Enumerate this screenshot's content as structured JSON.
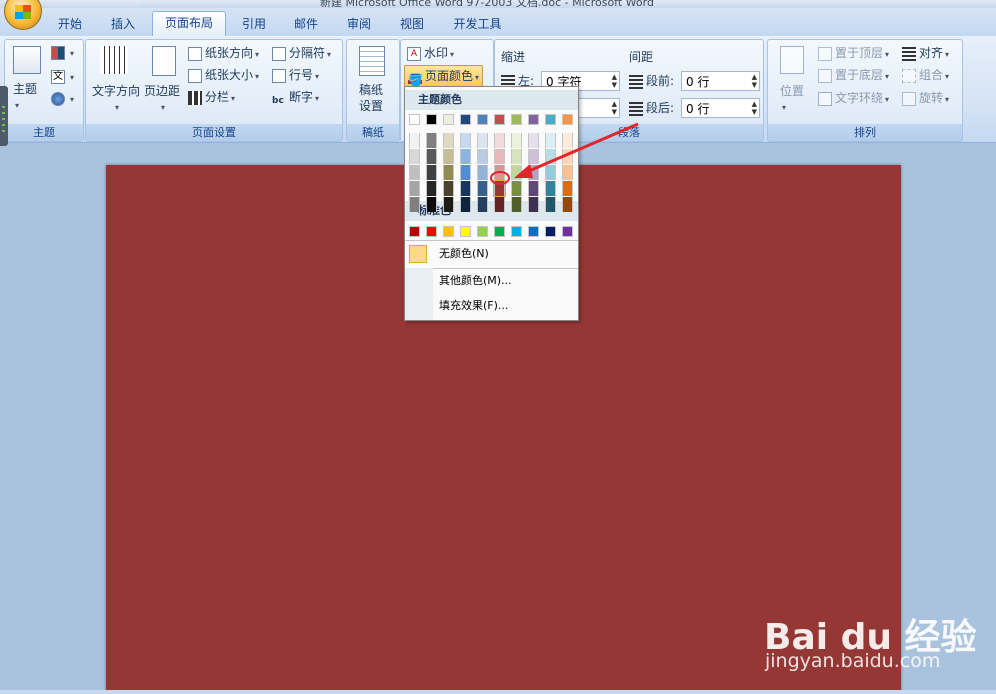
{
  "window": {
    "title": "新建 Microsoft Office Word 97-2003 文档.doc - Microsoft Word"
  },
  "tabs": [
    {
      "label": "开始"
    },
    {
      "label": "插入"
    },
    {
      "label": "页面布局"
    },
    {
      "label": "引用"
    },
    {
      "label": "邮件"
    },
    {
      "label": "审阅"
    },
    {
      "label": "视图"
    },
    {
      "label": "开发工具"
    }
  ],
  "active_tab": "页面布局",
  "ribbon": {
    "theme_group": {
      "label": "主题",
      "theme_button": "主题",
      "colors_button": "",
      "fonts_button": "文",
      "effects_button": ""
    },
    "page_setup_group": {
      "label": "页面设置",
      "text_direction": "文字方向",
      "margins": "页边距",
      "orientation": "纸张方向",
      "size": "纸张大小",
      "columns": "分栏",
      "breaks": "分隔符",
      "line_numbers": "行号",
      "hyphenation": "断字"
    },
    "draft_group": {
      "label": "稿纸",
      "button": "稿纸\n设置",
      "button_line1": "稿纸",
      "button_line2": "设置"
    },
    "background_group": {
      "watermark": "水印",
      "page_color": "页面颜色"
    },
    "paragraph_group": {
      "label": "段落",
      "indent_title": "缩进",
      "spacing_title": "间距",
      "indent_left_label": "左:",
      "indent_left_value": "0 字符",
      "spacing_before_label": "段前:",
      "spacing_before_value": "0 行",
      "spacing_after_label": "段后:",
      "spacing_after_value": "0 行"
    },
    "arrange_group": {
      "label": "排列",
      "position": "位置",
      "bring_to_front": "置于顶层",
      "send_to_back": "置于底层",
      "text_wrapping": "文字环绕",
      "align": "对齐",
      "group": "组合",
      "rotate": "旋转"
    }
  },
  "page_color_menu": {
    "theme_colors_header": "主题颜色",
    "standard_colors_header": "标准色",
    "theme_top_row": [
      "#ffffff",
      "#000000",
      "#eeece1",
      "#1f497d",
      "#4f81bd",
      "#c0504d",
      "#9bbb59",
      "#8064a2",
      "#4bacc6",
      "#f79646"
    ],
    "theme_shades": [
      [
        "#f2f2f2",
        "#7f7f7f",
        "#ddd9c3",
        "#c6d9f0",
        "#dbe5f1",
        "#f2dcdb",
        "#ebf1dd",
        "#e5e0ec",
        "#dbeef3",
        "#fdeada"
      ],
      [
        "#d8d8d8",
        "#595959",
        "#c4bd97",
        "#8db3e2",
        "#b8cce4",
        "#e5b9b7",
        "#d7e3bc",
        "#ccc1d9",
        "#b7dde8",
        "#fbd5b5"
      ],
      [
        "#bfbfbf",
        "#3f3f3f",
        "#938953",
        "#548dd4",
        "#95b3d7",
        "#d99694",
        "#c3d69b",
        "#b2a2c7",
        "#92cddc",
        "#fac08f"
      ],
      [
        "#a5a5a5",
        "#262626",
        "#494429",
        "#17365d",
        "#366092",
        "#953734",
        "#76923c",
        "#5f497a",
        "#31859b",
        "#e36c09"
      ],
      [
        "#7f7f7f",
        "#0c0c0c",
        "#1d1b10",
        "#0f243e",
        "#244061",
        "#632423",
        "#4f6128",
        "#3f3151",
        "#205867",
        "#974806"
      ]
    ],
    "standard_colors": [
      "#c00000",
      "#ff0000",
      "#ffc000",
      "#ffff00",
      "#92d050",
      "#00b050",
      "#00b0f0",
      "#0070c0",
      "#002060",
      "#7030a0"
    ],
    "no_color": "无颜色(N)",
    "more_colors": "其他颜色(M)...",
    "fill_effects": "填充效果(F)...",
    "selected_color": "#953734",
    "annotation_color": "#e0262a"
  },
  "document": {
    "page_color": "#953735"
  },
  "watermark": {
    "brand": "Bai du 经验",
    "url": "jingyan.baidu.com"
  }
}
